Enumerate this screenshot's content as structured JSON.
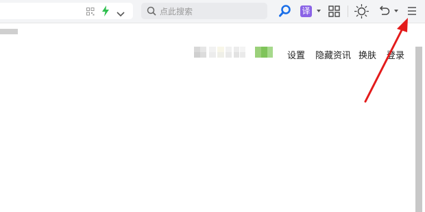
{
  "toolbar": {
    "search_placeholder": "点此搜索",
    "translate_label": "译"
  },
  "page": {
    "top_links": [
      {
        "label": "设置"
      },
      {
        "label": "隐藏资讯"
      },
      {
        "label": "换肤"
      },
      {
        "label": "登录"
      }
    ]
  },
  "colors": {
    "accent_blue": "#1a6ee8",
    "translate_purple": "#8a63e6",
    "bolt_green": "#2fbf4f",
    "annotation_red": "#e31b1b"
  },
  "icons": {
    "qr": "qr-code-icon",
    "bolt": "lightning-icon",
    "chevron": "chevron-down-icon",
    "search": "search-icon",
    "search_engine": "search-engine-icon",
    "translate": "translate-icon",
    "apps": "apps-grid-icon",
    "brightness": "brightness-icon",
    "undo": "undo-icon",
    "menu": "menu-icon"
  }
}
